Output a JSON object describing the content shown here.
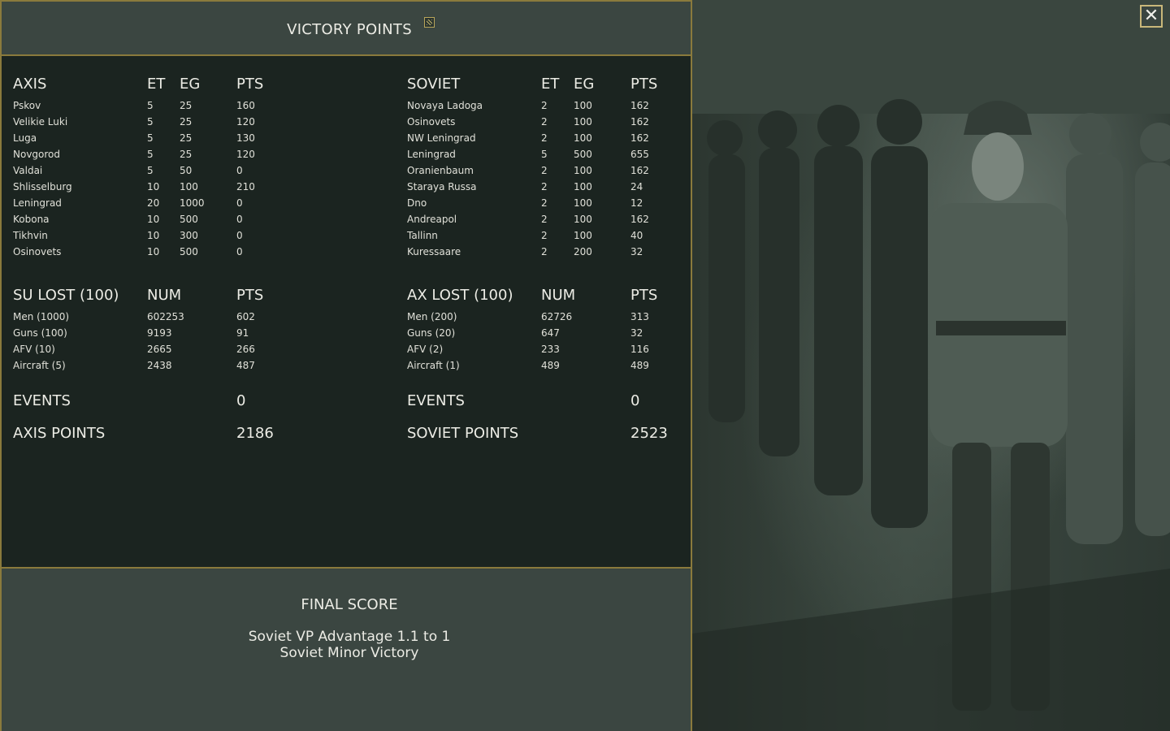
{
  "header": {
    "title": "VICTORY POINTS",
    "icon": "report-icon"
  },
  "axis_cities": {
    "headers": [
      "AXIS",
      "ET",
      "EG",
      "PTS"
    ],
    "rows": [
      [
        "Pskov",
        "5",
        "25",
        "160"
      ],
      [
        "Velikie Luki",
        "5",
        "25",
        "120"
      ],
      [
        "Luga",
        "5",
        "25",
        "130"
      ],
      [
        "Novgorod",
        "5",
        "25",
        "120"
      ],
      [
        "Valdai",
        "5",
        "50",
        "0"
      ],
      [
        "Shlisselburg",
        "10",
        "100",
        "210"
      ],
      [
        "Leningrad",
        "20",
        "1000",
        "0"
      ],
      [
        "Kobona",
        "10",
        "500",
        "0"
      ],
      [
        "Tikhvin",
        "10",
        "300",
        "0"
      ],
      [
        "Osinovets",
        "10",
        "500",
        "0"
      ]
    ]
  },
  "soviet_cities": {
    "headers": [
      "SOVIET",
      "ET",
      "EG",
      "PTS"
    ],
    "rows": [
      [
        "Novaya Ladoga",
        "2",
        "100",
        "162"
      ],
      [
        "Osinovets",
        "2",
        "100",
        "162"
      ],
      [
        "NW Leningrad",
        "2",
        "100",
        "162"
      ],
      [
        "Leningrad",
        "5",
        "500",
        "655"
      ],
      [
        "Oranienbaum",
        "2",
        "100",
        "162"
      ],
      [
        "Staraya Russa",
        "2",
        "100",
        "24"
      ],
      [
        "Dno",
        "2",
        "100",
        "12"
      ],
      [
        "Andreapol",
        "2",
        "100",
        "162"
      ],
      [
        "Tallinn",
        "2",
        "100",
        "40"
      ],
      [
        "Kuressaare",
        "2",
        "200",
        "32"
      ]
    ]
  },
  "su_lost": {
    "headers": [
      "SU LOST (100)",
      "NUM",
      "PTS"
    ],
    "rows": [
      [
        "Men (1000)",
        "602253",
        "602"
      ],
      [
        "Guns (100)",
        "9193",
        "91"
      ],
      [
        "AFV (10)",
        "2665",
        "266"
      ],
      [
        "Aircraft (5)",
        "2438",
        "487"
      ]
    ]
  },
  "ax_lost": {
    "headers": [
      "AX LOST (100)",
      "NUM",
      "PTS"
    ],
    "rows": [
      [
        "Men (200)",
        "62726",
        "313"
      ],
      [
        "Guns (20)",
        "647",
        "32"
      ],
      [
        "AFV (2)",
        "233",
        "116"
      ],
      [
        "Aircraft (1)",
        "489",
        "489"
      ]
    ]
  },
  "axis_summary": {
    "events_label": "EVENTS",
    "events_value": "0",
    "points_label": "AXIS POINTS",
    "points_value": "2186"
  },
  "soviet_summary": {
    "events_label": "EVENTS",
    "events_value": "0",
    "points_label": "SOVIET POINTS",
    "points_value": "2523"
  },
  "final": {
    "title": "FINAL SCORE",
    "line1": "Soviet VP Advantage 1.1 to 1",
    "line2": "Soviet Minor Victory"
  },
  "close_button": {
    "symbol": "✕"
  },
  "colors": {
    "accent_border": "#8a7a3c",
    "panel_bg": "#1b2420",
    "header_bg": "#3b4641"
  }
}
